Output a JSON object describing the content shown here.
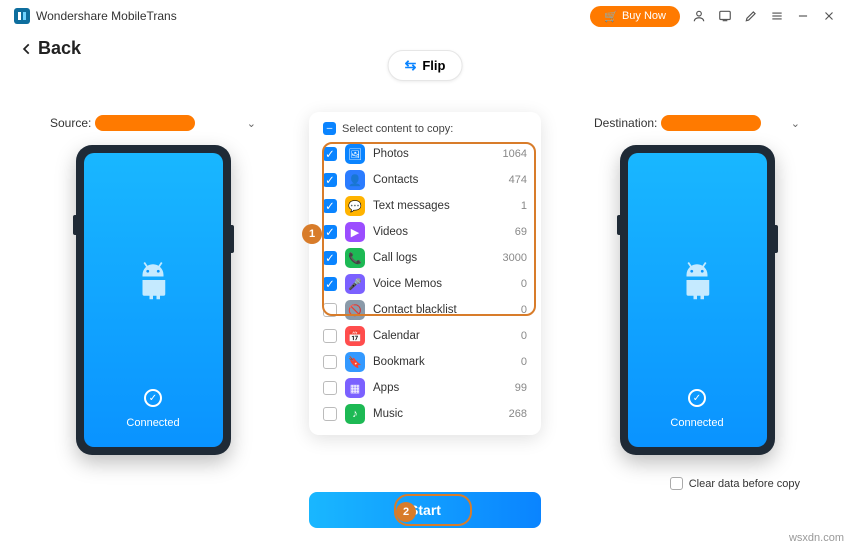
{
  "app": {
    "title": "Wondershare MobileTrans"
  },
  "titlebar": {
    "buy_now": "Buy Now"
  },
  "nav": {
    "back": "Back",
    "flip": "Flip"
  },
  "source": {
    "label": "Source:",
    "connected": "Connected"
  },
  "destination": {
    "label": "Destination:",
    "connected": "Connected"
  },
  "panel": {
    "header": "Select content to copy:",
    "items": [
      {
        "label": "Photos",
        "count": "1064",
        "checked": true,
        "icon_bg": "#0a84ff",
        "icon_glyph": "🖼"
      },
      {
        "label": "Contacts",
        "count": "474",
        "checked": true,
        "icon_bg": "#2b7cff",
        "icon_glyph": "👤"
      },
      {
        "label": "Text messages",
        "count": "1",
        "checked": true,
        "icon_bg": "#ffb300",
        "icon_glyph": "💬"
      },
      {
        "label": "Videos",
        "count": "69",
        "checked": true,
        "icon_bg": "#9b4dff",
        "icon_glyph": "▶"
      },
      {
        "label": "Call logs",
        "count": "3000",
        "checked": true,
        "icon_bg": "#1db954",
        "icon_glyph": "📞"
      },
      {
        "label": "Voice Memos",
        "count": "0",
        "checked": true,
        "icon_bg": "#7b61ff",
        "icon_glyph": "🎤"
      },
      {
        "label": "Contact blacklist",
        "count": "0",
        "checked": false,
        "icon_bg": "#8a9aa9",
        "icon_glyph": "🚫"
      },
      {
        "label": "Calendar",
        "count": "0",
        "checked": false,
        "icon_bg": "#ff4d4d",
        "icon_glyph": "📅"
      },
      {
        "label": "Bookmark",
        "count": "0",
        "checked": false,
        "icon_bg": "#3399ff",
        "icon_glyph": "🔖"
      },
      {
        "label": "Apps",
        "count": "99",
        "checked": false,
        "icon_bg": "#7b61ff",
        "icon_glyph": "▦"
      },
      {
        "label": "Music",
        "count": "268",
        "checked": false,
        "icon_bg": "#1db954",
        "icon_glyph": "♪"
      }
    ]
  },
  "actions": {
    "start": "Start",
    "clear_data": "Clear data before copy"
  },
  "annotations": {
    "one": "1",
    "two": "2"
  },
  "watermark": "wsxdn.com"
}
